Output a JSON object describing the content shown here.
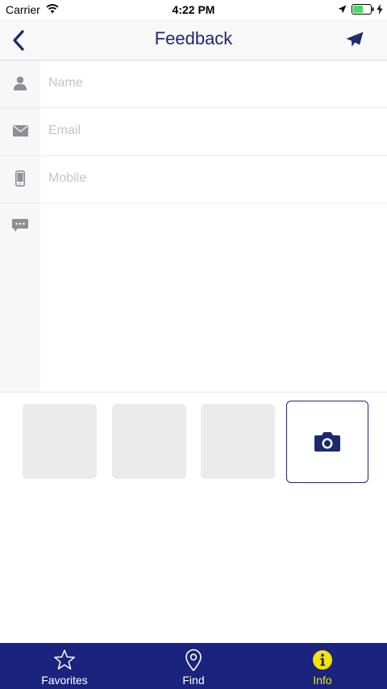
{
  "status_bar": {
    "carrier": "Carrier",
    "time": "4:22 PM"
  },
  "nav": {
    "title": "Feedback",
    "back_icon": "chevron-left-icon",
    "send_icon": "paper-plane-icon"
  },
  "form": {
    "name_placeholder": "Name",
    "email_placeholder": "Email",
    "mobile_placeholder": "Mobile"
  },
  "attachments": {
    "slots": 3,
    "camera_icon": "camera-icon"
  },
  "tabs": [
    {
      "label": "Favorites",
      "icon": "star-icon",
      "active": false
    },
    {
      "label": "Find",
      "icon": "location-pin-icon",
      "active": false
    },
    {
      "label": "Info",
      "icon": "info-icon",
      "active": true
    }
  ],
  "colors": {
    "accent": "#1c2a6b",
    "tab_bar": "#1a237e",
    "tab_active": "#f4e400",
    "battery": "#4cd964"
  }
}
